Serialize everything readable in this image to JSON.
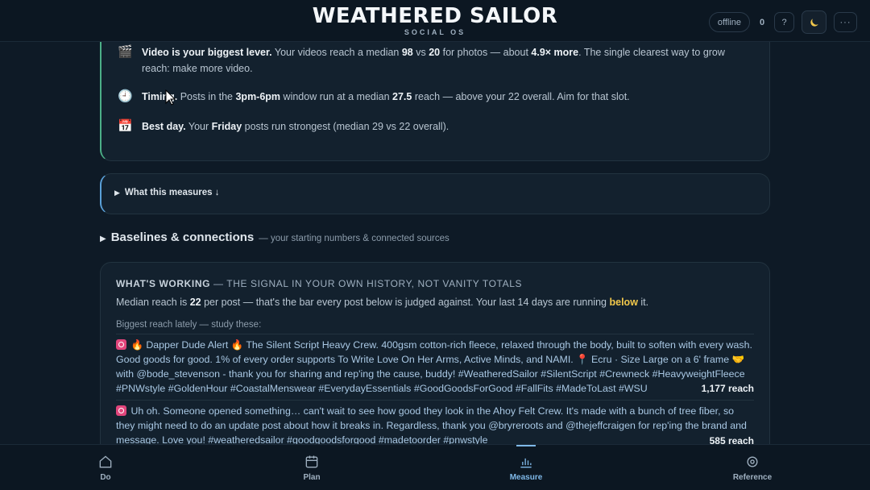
{
  "header": {
    "app_title": "WEATHERED SAILOR",
    "app_subtitle": "SOCIAL OS",
    "status": "offline",
    "count": "0",
    "help": "?",
    "theme_icon": "moon-icon",
    "more": "···"
  },
  "insights": [
    {
      "icon": "🎬",
      "title": "Video is your biggest lever.",
      "text1": " Your videos reach a median ",
      "n1": "98",
      "text2": " vs ",
      "n2": "20",
      "text3": " for photos — about ",
      "n3": "4.9× more",
      "text4": ". The single clearest way to grow reach: make more video."
    },
    {
      "icon": "🕘",
      "title": "Timing.",
      "text1": " Posts in the ",
      "n1": "3pm-6pm",
      "text2": " window run at a median ",
      "n2": "27.5",
      "text3": " reach — above your 22 overall. Aim for that slot."
    },
    {
      "icon": "📅",
      "title": "Best day.",
      "text1": " Your ",
      "n1": "Friday",
      "text2": " posts run strongest (median 29 vs 22 overall)."
    }
  ],
  "measures": {
    "label": "What this measures ↓"
  },
  "baselines": {
    "title": "Baselines & connections",
    "subtitle": "— your starting numbers & connected sources"
  },
  "working": {
    "heading_bold": "WHAT'S WORKING",
    "heading_rest": " — THE SIGNAL IN YOUR OWN HISTORY, NOT VANITY TOTALS",
    "median_pre": "Median reach is ",
    "median_value": "22",
    "median_mid": " per post — that's the bar every post below is judged against. Your last 14 days are running ",
    "median_status": "below",
    "median_post": " it.",
    "study_label": "Biggest reach lately — study these:",
    "posts": [
      {
        "platform_icon": "instagram-icon",
        "text": "🔥 Dapper Dude Alert 🔥 The Silent Script Heavy Crew. 400gsm cotton-rich fleece, relaxed through the body, built to soften with every wash. Good goods for good. 1% of every order supports To Write Love On Her Arms, Active Minds, and NAMI. 📍 Ecru · Size Large on a 6' frame 🤝 with @bode_stevenson - thank you for sharing and rep'ing the cause, buddy! #WeatheredSailor #SilentScript #Crewneck #HeavyweightFleece #PNWstyle #GoldenHour #CoastalMenswear #EverydayEssentials #GoodGoodsForGood #FallFits #MadeToLast #WSU",
        "reach": "1,177 reach"
      },
      {
        "platform_icon": "instagram-icon",
        "text": "Uh oh. Someone opened something… can't wait to see how good they look in the Ahoy Felt Crew. It's made with a bunch of tree fiber, so they might need to do an update post about how it breaks in. Regardless, thank you @bryreroots and @thejeffcraigen for rep'ing the brand and message. Love you! #weatheredsailor #goodgoodsforgood #madetoorder #pnwstyle",
        "reach": "585 reach"
      }
    ]
  },
  "nav": [
    {
      "label": "Do",
      "icon": "home-icon"
    },
    {
      "label": "Plan",
      "icon": "calendar-icon"
    },
    {
      "label": "Measure",
      "icon": "chart-icon",
      "active": true
    },
    {
      "label": "Reference",
      "icon": "target-icon"
    }
  ]
}
